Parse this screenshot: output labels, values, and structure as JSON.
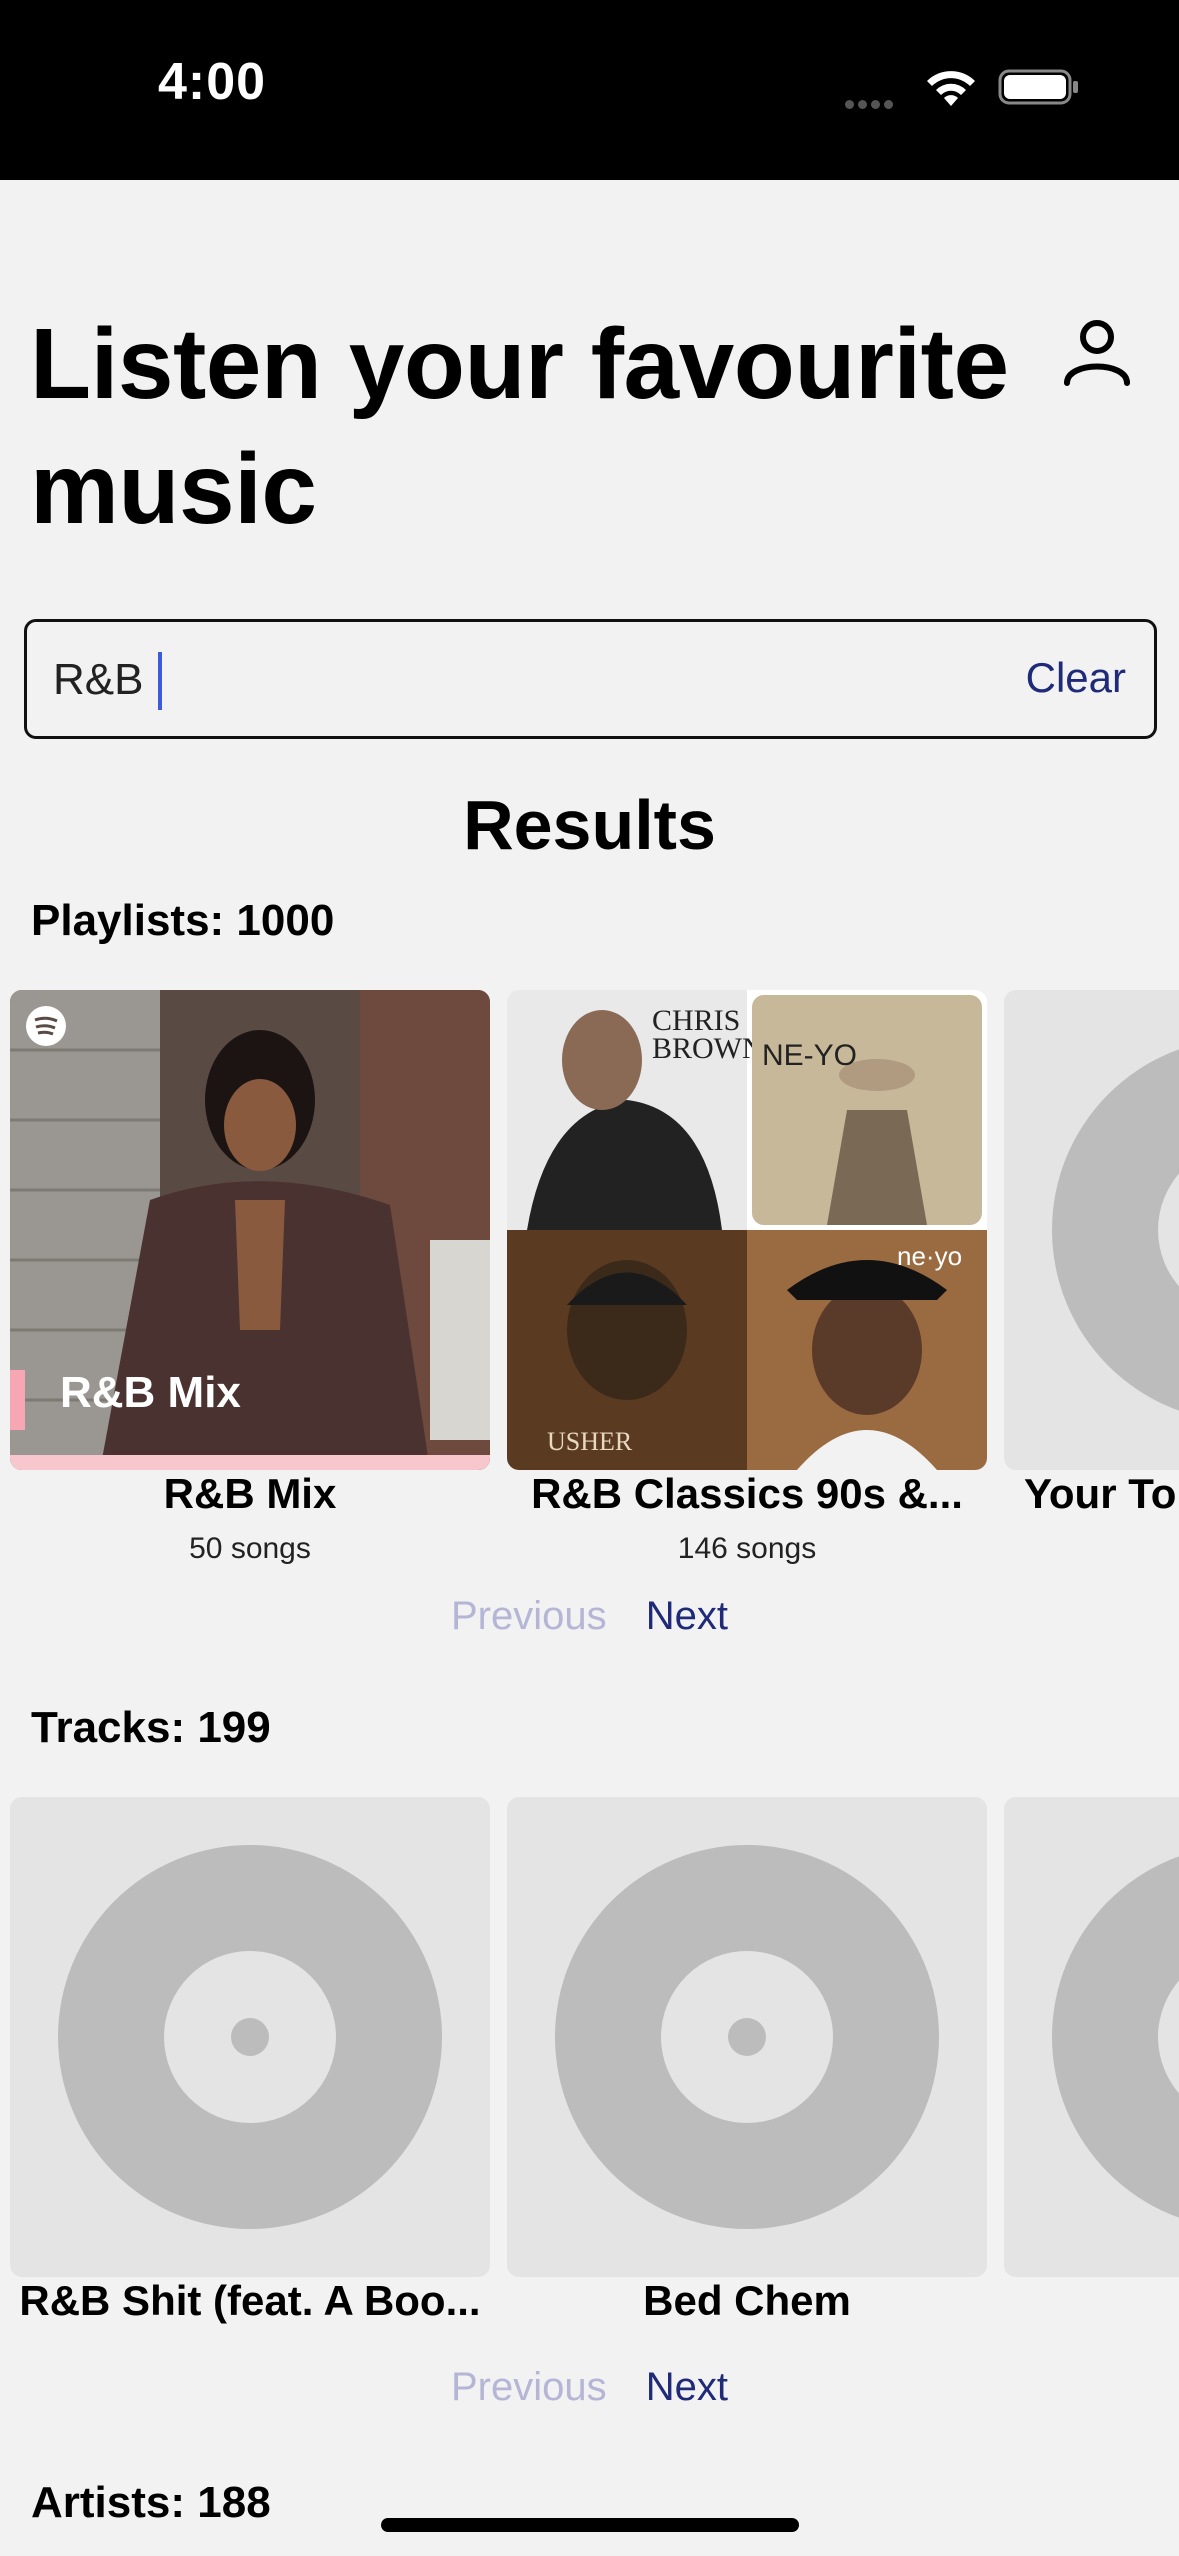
{
  "status": {
    "time": "4:00"
  },
  "header": {
    "title": "Listen your favourite music",
    "profile_icon": "person-icon"
  },
  "search": {
    "value": "R&B",
    "placeholder": "",
    "clear_label": "Clear"
  },
  "results": {
    "title": "Results"
  },
  "playlists": {
    "label": "Playlists: 1000",
    "items": [
      {
        "title": "R&B Mix",
        "subtitle": "50 songs",
        "overlay": "R&B Mix"
      },
      {
        "title": "R&B Classics  90s &...",
        "subtitle": "146 songs"
      },
      {
        "title": "Your To",
        "subtitle": ""
      }
    ],
    "pager": {
      "previous": "Previous",
      "next": "Next"
    }
  },
  "tracks": {
    "label": "Tracks: 199",
    "items": [
      {
        "title": "R&B Shit (feat. A Boo..."
      },
      {
        "title": "Bed Chem"
      },
      {
        "title": ""
      }
    ],
    "pager": {
      "previous": "Previous",
      "next": "Next"
    }
  },
  "artists": {
    "label": "Artists: 188"
  },
  "colors": {
    "accent": "#1f2a78",
    "disabled": "#b5b6d6",
    "caret": "#3b5bdb",
    "placeholder_art": "#e4e4e4",
    "vinyl": "#bcbcbc"
  }
}
